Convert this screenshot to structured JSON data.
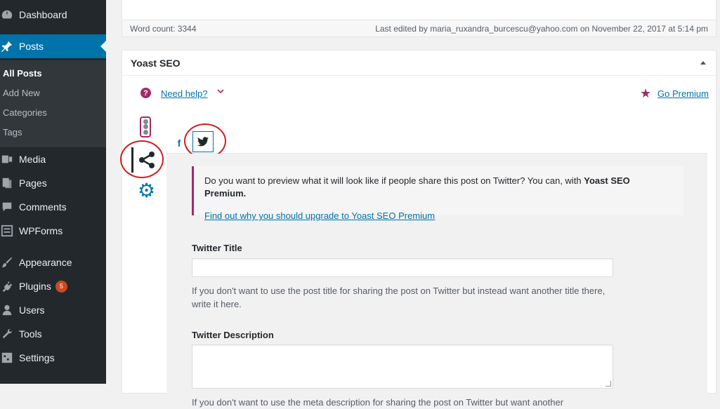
{
  "sidebar": {
    "items": [
      {
        "label": "Dashboard",
        "icon": "dashboard-icon"
      },
      {
        "label": "Posts",
        "icon": "pushpin-icon"
      },
      {
        "label": "Media",
        "icon": "media-icon"
      },
      {
        "label": "Pages",
        "icon": "pages-icon"
      },
      {
        "label": "Comments",
        "icon": "comments-icon"
      },
      {
        "label": "WPForms",
        "icon": "wpforms-icon"
      },
      {
        "label": "Appearance",
        "icon": "brush-icon"
      },
      {
        "label": "Plugins",
        "icon": "plugins-icon",
        "badge": "5"
      },
      {
        "label": "Users",
        "icon": "users-icon"
      },
      {
        "label": "Tools",
        "icon": "wrench-icon"
      },
      {
        "label": "Settings",
        "icon": "settings-icon"
      }
    ],
    "posts_submenu": [
      "All Posts",
      "Add New",
      "Categories",
      "Tags"
    ]
  },
  "editor": {
    "word_count": "Word count: 3344",
    "last_edited": "Last edited by maria_ruxandra_burcescu@yahoo.com on November 22, 2017 at 5:14 pm"
  },
  "yoast": {
    "title": "Yoast SEO",
    "help_link": "Need help?",
    "premium_link": "Go Premium",
    "network_tabs": [
      "facebook-icon",
      "twitter-icon"
    ],
    "upsell_text": "Do you want to preview what it will look like if people share this post on Twitter? You can, with ",
    "upsell_bold": "Yoast SEO Premium.",
    "upsell_link": "Find out why you should upgrade to Yoast SEO Premium",
    "twitter_title_label": "Twitter Title",
    "twitter_title_value": "",
    "twitter_title_help": "If you don't want to use the post title for sharing the post on Twitter but instead want another title there, write it here.",
    "twitter_desc_label": "Twitter Description",
    "twitter_desc_value": "",
    "twitter_desc_help": "If you don't want to use the meta description for sharing the post on Twitter but want another"
  },
  "colors": {
    "sidebar_bg": "#23282d",
    "active_blue": "#0073aa",
    "yoast_purple": "#a4286a",
    "annotation_red": "#d01f1f"
  }
}
